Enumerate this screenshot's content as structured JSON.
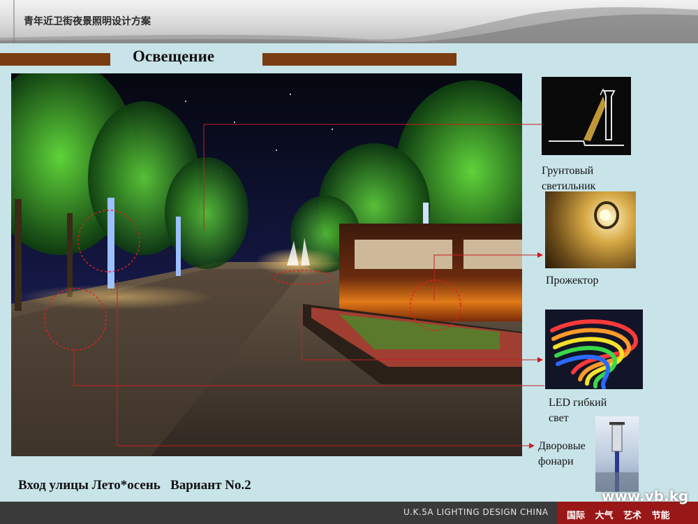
{
  "header": {
    "title": "青年近卫街夜景照明设计方案"
  },
  "slide": {
    "title": "Освещение"
  },
  "callouts": [
    {
      "label_line1": "Грунтовый",
      "label_line2": "светильник"
    },
    {
      "label_line1": "Прожектор",
      "label_line2": ""
    },
    {
      "label_line1": "LED гибкий",
      "label_line2": "свет"
    },
    {
      "label_line1": "Дворовые",
      "label_line2": "фонари"
    }
  ],
  "bottom_caption": "Вход улицы Лето*осень   Вариант No.2",
  "footer": {
    "brand": "U.K.5A LIGHTING DESIGN CHINA",
    "tags": "国际 大气 艺术 节能"
  },
  "watermark": "www.vb.kg",
  "colors": {
    "accent_bar": "#7a3c10",
    "callout_line": "#c81e1e",
    "footer_red": "#9a1717"
  }
}
